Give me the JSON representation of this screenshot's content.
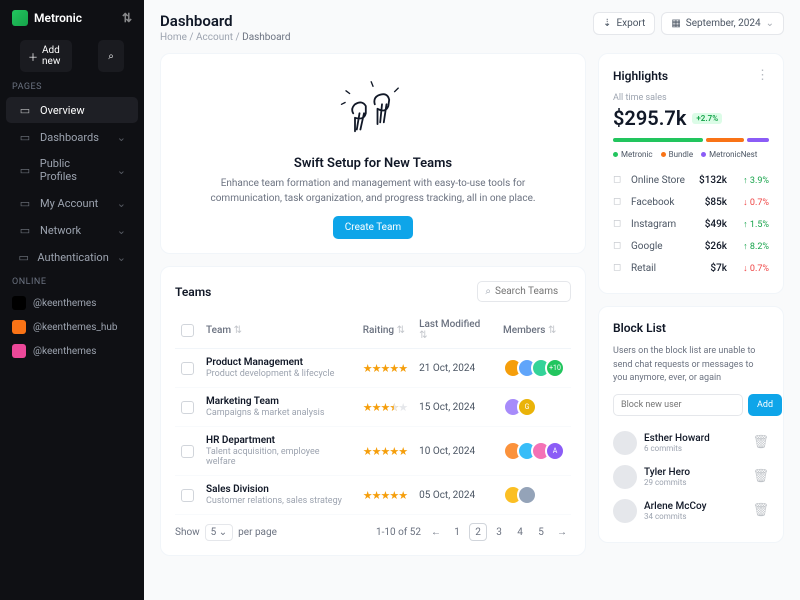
{
  "brand": "Metronic",
  "add_new": "Add new",
  "sections": {
    "pages": "PAGES",
    "online": "ONLINE"
  },
  "nav": [
    {
      "label": "Overview",
      "active": true
    },
    {
      "label": "Dashboards",
      "chev": true
    },
    {
      "label": "Public Profiles",
      "chev": true
    },
    {
      "label": "My Account",
      "chev": true
    },
    {
      "label": "Network",
      "chev": true
    },
    {
      "label": "Authentication",
      "chev": true
    }
  ],
  "online": [
    {
      "label": "@keenthemes",
      "color": "#000"
    },
    {
      "label": "@keenthemes_hub",
      "color": "#f97316"
    },
    {
      "label": "@keenthemes",
      "color": "#ec4899"
    }
  ],
  "header": {
    "title": "Dashboard",
    "crumbs": [
      "Home",
      "Account",
      "Dashboard"
    ],
    "export": "Export",
    "period": "September, 2024"
  },
  "swift": {
    "title": "Swift Setup for New Teams",
    "desc": "Enhance team formation and management with easy-to-use tools for communication, task organization, and progress tracking, all in one place.",
    "cta": "Create Team"
  },
  "teams": {
    "title": "Teams",
    "search_ph": "Search Teams",
    "cols": [
      "Team",
      "Raiting",
      "Last Modified",
      "Members"
    ],
    "rows": [
      {
        "name": "Product Management",
        "desc": "Product development & lifecycle",
        "stars": 5,
        "half": false,
        "date": "21 Oct, 2024",
        "avs": [
          "#f59e0b",
          "#60a5fa",
          "#34d399"
        ],
        "more": "+10",
        "morec": "#22c55e"
      },
      {
        "name": "Marketing Team",
        "desc": "Campaigns & market analysis",
        "stars": 3,
        "half": true,
        "date": "15 Oct, 2024",
        "avs": [
          "#a78bfa"
        ],
        "more": "G",
        "morec": "#eab308"
      },
      {
        "name": "HR Department",
        "desc": "Talent acquisition, employee welfare",
        "stars": 5,
        "half": false,
        "date": "10 Oct, 2024",
        "avs": [
          "#fb923c",
          "#38bdf8",
          "#f472b6"
        ],
        "more": "A",
        "morec": "#8b5cf6"
      },
      {
        "name": "Sales Division",
        "desc": "Customer relations, sales strategy",
        "stars": 5,
        "half": false,
        "date": "05 Oct, 2024",
        "avs": [
          "#fbbf24",
          "#94a3b8"
        ],
        "more": null
      }
    ],
    "pager": {
      "show": "Show",
      "per": "per page",
      "sel": "5",
      "range": "1-10 of 52",
      "pages": [
        "1",
        "2",
        "3",
        "4",
        "5"
      ],
      "current": "2"
    }
  },
  "highlights": {
    "title": "Highlights",
    "sub": "All time sales",
    "value": "$295.7k",
    "delta": "+2.7%",
    "bar": [
      {
        "c": "#22c55e",
        "w": 58
      },
      {
        "c": "#f97316",
        "w": 25
      },
      {
        "c": "#8b5cf6",
        "w": 14
      }
    ],
    "legend": [
      {
        "c": "#22c55e",
        "t": "Metronic"
      },
      {
        "c": "#f97316",
        "t": "Bundle"
      },
      {
        "c": "#8b5cf6",
        "t": "MetronicNest"
      }
    ],
    "channels": [
      {
        "name": "Online Store",
        "val": "$132k",
        "pct": "3.9%",
        "dir": "up"
      },
      {
        "name": "Facebook",
        "val": "$85k",
        "pct": "0.7%",
        "dir": "dn"
      },
      {
        "name": "Instagram",
        "val": "$49k",
        "pct": "1.5%",
        "dir": "up"
      },
      {
        "name": "Google",
        "val": "$26k",
        "pct": "8.2%",
        "dir": "up"
      },
      {
        "name": "Retail",
        "val": "$7k",
        "pct": "0.7%",
        "dir": "dn"
      }
    ]
  },
  "blocklist": {
    "title": "Block List",
    "desc": "Users on the block list are unable to send chat requests or messages to you anymore, ever, or again",
    "ph": "Block new user",
    "add": "Add",
    "users": [
      {
        "name": "Esther Howard",
        "sub": "6 commits"
      },
      {
        "name": "Tyler Hero",
        "sub": "29 commits"
      },
      {
        "name": "Arlene McCoy",
        "sub": "34 commits"
      }
    ]
  }
}
